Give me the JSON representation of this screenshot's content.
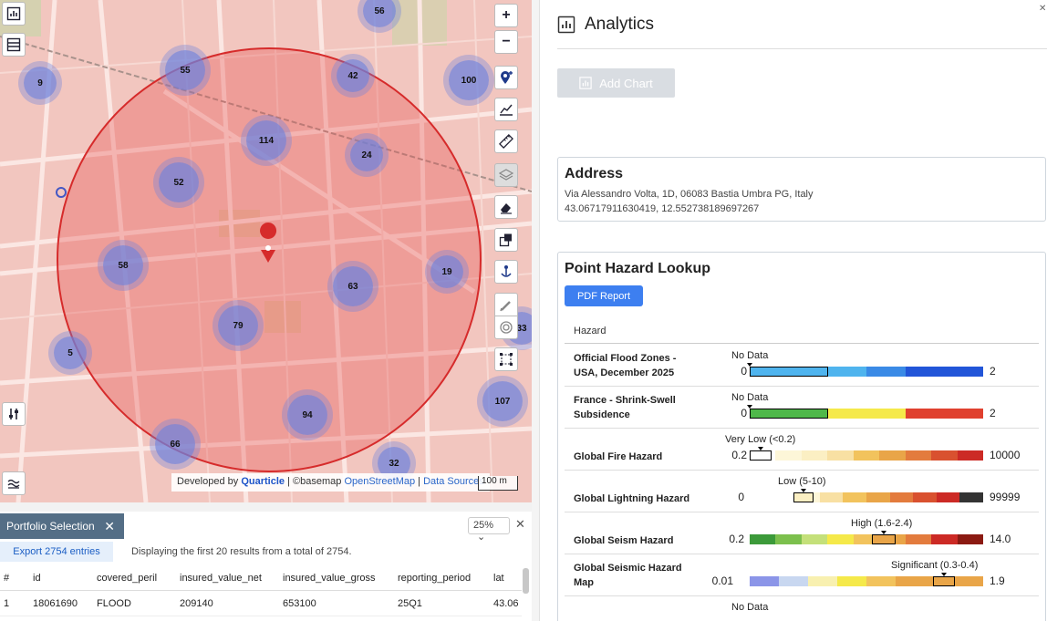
{
  "map": {
    "clusters": [
      "56",
      "55",
      "42",
      "100",
      "9",
      "114",
      "24",
      "52",
      "58",
      "19",
      "63",
      "79",
      "5",
      "94",
      "107",
      "66",
      "32",
      "33"
    ],
    "controls": {
      "zoom_in": "+",
      "zoom_out": "−"
    },
    "attribution": {
      "developed_by": "Developed by",
      "brand": "Quarticle",
      "basemap": "| ©basemap",
      "osm": "OpenStreetMap",
      "sep": "|",
      "sources": "Data Sources"
    },
    "scale": "100 m",
    "circle_color": "#d62b2b"
  },
  "portfolio": {
    "tab_label": "Portfolio Selection",
    "tab_close": "✕",
    "zoom": "25%",
    "zoom_chevron": "⌄",
    "close": "✕",
    "export_label": "Export 2754 entries",
    "info": "Displaying the first 20 results from a total of 2754.",
    "columns": [
      "#",
      "id",
      "covered_peril",
      "insured_value_net",
      "insured_value_gross",
      "reporting_period",
      "lat"
    ],
    "rows": [
      [
        "1",
        "18061690",
        "FLOOD",
        "209140",
        "653100",
        "25Q1",
        "43.06"
      ]
    ]
  },
  "panel": {
    "close": "✕",
    "title": "Analytics",
    "add_chart": "Add Chart",
    "address": {
      "title": "Address",
      "line1": "Via Alessandro Volta, 1D, 06083 Bastia Umbra PG, Italy",
      "line2": "43.06717911630419, 12.552738189697267"
    },
    "hazard": {
      "title": "Point Hazard Lookup",
      "pdf_button": "PDF Report",
      "column_header": "Hazard",
      "rows": [
        {
          "name": "Official Flood Zones - USA, December 2025",
          "value": "No Data",
          "min": "0",
          "max": "2"
        },
        {
          "name": "France - Shrink-Swell Subsidence",
          "value": "No Data",
          "min": "0",
          "max": "2"
        },
        {
          "name": "Global Fire Hazard",
          "value": "Very Low (<0.2)",
          "min": "0.2",
          "max": "10000"
        },
        {
          "name": "Global Lightning Hazard",
          "value": "Low (5-10)",
          "min": "0",
          "max": "99999"
        },
        {
          "name": "Global Seism Hazard",
          "value": "High (1.6-2.4)",
          "min": "0.2",
          "max": "14.0"
        },
        {
          "name": "Global Seismic Hazard Map",
          "value": "Significant (0.3-0.4)",
          "min": "0.01",
          "max": "1.9"
        },
        {
          "name": "",
          "value": "No Data",
          "min": "",
          "max": ""
        }
      ]
    }
  }
}
